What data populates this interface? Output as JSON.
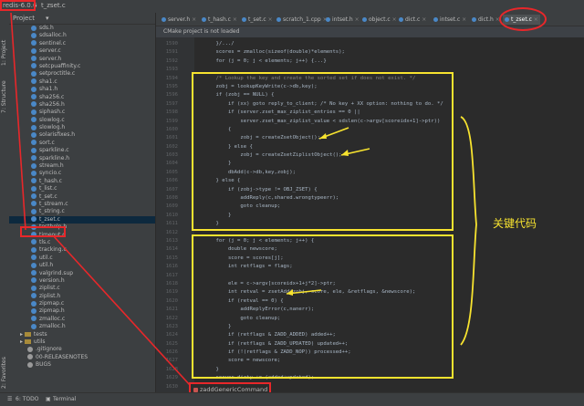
{
  "breadcrumb": {
    "project": "redis-6.0.6",
    "file": "t_zset.c"
  },
  "left_tool_tabs": [
    "1: Project",
    "7: Structure",
    "2: Favorites"
  ],
  "project_panel": {
    "title": "Project"
  },
  "files": [
    {
      "name": "sds.h",
      "selected": false
    },
    {
      "name": "sdsalloc.h",
      "selected": false
    },
    {
      "name": "sentinel.c",
      "selected": false
    },
    {
      "name": "server.c",
      "selected": false
    },
    {
      "name": "server.h",
      "selected": false
    },
    {
      "name": "setcpuaffinity.c",
      "selected": false
    },
    {
      "name": "setproctitle.c",
      "selected": false
    },
    {
      "name": "sha1.c",
      "selected": false
    },
    {
      "name": "sha1.h",
      "selected": false
    },
    {
      "name": "sha256.c",
      "selected": false
    },
    {
      "name": "sha256.h",
      "selected": false
    },
    {
      "name": "siphash.c",
      "selected": false
    },
    {
      "name": "slowlog.c",
      "selected": false
    },
    {
      "name": "slowlog.h",
      "selected": false
    },
    {
      "name": "solarisfixes.h",
      "selected": false
    },
    {
      "name": "sort.c",
      "selected": false
    },
    {
      "name": "sparkline.c",
      "selected": false
    },
    {
      "name": "sparkline.h",
      "selected": false
    },
    {
      "name": "stream.h",
      "selected": false
    },
    {
      "name": "syncio.c",
      "selected": false
    },
    {
      "name": "t_hash.c",
      "selected": false
    },
    {
      "name": "t_list.c",
      "selected": false
    },
    {
      "name": "t_set.c",
      "selected": false
    },
    {
      "name": "t_stream.c",
      "selected": false
    },
    {
      "name": "t_string.c",
      "selected": false
    },
    {
      "name": "t_zset.c",
      "selected": true
    },
    {
      "name": "testhelp.h",
      "selected": false
    },
    {
      "name": "timeout.c",
      "selected": false
    },
    {
      "name": "tls.c",
      "selected": false
    },
    {
      "name": "tracking.c",
      "selected": false
    },
    {
      "name": "util.c",
      "selected": false
    },
    {
      "name": "util.h",
      "selected": false
    },
    {
      "name": "valgrind.sup",
      "selected": false
    },
    {
      "name": "version.h",
      "selected": false
    },
    {
      "name": "ziplist.c",
      "selected": false
    },
    {
      "name": "ziplist.h",
      "selected": false
    },
    {
      "name": "zipmap.c",
      "selected": false
    },
    {
      "name": "zipmap.h",
      "selected": false
    },
    {
      "name": "zmalloc.c",
      "selected": false
    },
    {
      "name": "zmalloc.h",
      "selected": false
    }
  ],
  "folders": [
    {
      "name": "tests"
    },
    {
      "name": "utils"
    }
  ],
  "root_files": [
    ".gitignore",
    "00-RELEASENOTES",
    "BUGS"
  ],
  "editor_tabs": [
    {
      "label": "server.h",
      "active": false
    },
    {
      "label": "t_hash.c",
      "active": false
    },
    {
      "label": "t_set.c",
      "active": false
    },
    {
      "label": "scratch_1.cpp",
      "active": false
    },
    {
      "label": "intset.h",
      "active": false
    },
    {
      "label": "object.c",
      "active": false
    },
    {
      "label": "dict.c",
      "active": false
    },
    {
      "label": "intset.c",
      "active": false
    },
    {
      "label": "dict.h",
      "active": false
    },
    {
      "label": "t_zset.c",
      "active": true
    }
  ],
  "notice": "CMake project is not loaded",
  "line_numbers": [
    "1590",
    "1591",
    "1592",
    "1593",
    "1594",
    "1595",
    "1596",
    "1597",
    "1598",
    "1599",
    "1600",
    "1601",
    "1602",
    "1603",
    "1604",
    "1605",
    "1606",
    "1607",
    "1608",
    "1609",
    "1610",
    "1611",
    "1612",
    "1613",
    "1614",
    "1615",
    "1616",
    "1617",
    "1618",
    "1619",
    "1620",
    "1621",
    "1622",
    "1623",
    "1624",
    "1625",
    "1626",
    "1627",
    "1628",
    "1629",
    "1630",
    "1631",
    "1632",
    "1633",
    "1634",
    "1635",
    "1636",
    "1637",
    "1638",
    "1639",
    "1640"
  ],
  "code_lines": [
    "    }/.../",
    "    scores = zmalloc(sizeof(double)*elements);",
    "    for (j = 0; j < elements; j++) {...}",
    "",
    "    /* Lookup the key and create the sorted set if does not exist. */",
    "    zobj = lookupKeyWrite(c->db,key);",
    "    if (zobj == NULL) {",
    "        if (xx) goto reply_to_client; /* No key + XX option: nothing to do. */",
    "        if (server.zset_max_ziplist_entries == 0 ||",
    "            server.zset_max_ziplist_value < sdslen(c->argv[scoreidx+1]->ptr))",
    "        {",
    "            zobj = createZsetObject();",
    "        } else {",
    "            zobj = createZsetZiplistObject();",
    "        }",
    "        dbAdd(c->db,key,zobj);",
    "    } else {",
    "        if (zobj->type != OBJ_ZSET) {",
    "            addReply(c,shared.wrongtypeerr);",
    "            goto cleanup;",
    "        }",
    "    }",
    "",
    "    for (j = 0; j < elements; j++) {",
    "        double newscore;",
    "        score = scores[j];",
    "        int retflags = flags;",
    "",
    "        ele = c->argv[scoreidx+1+j*2]->ptr;",
    "        int retval = zsetAdd(zobj, score, ele, &retflags, &newscore);",
    "        if (retval == 0) {",
    "            addReplyError(c,nanerr);",
    "            goto cleanup;",
    "        }",
    "        if (retflags & ZADD_ADDED) added++;",
    "        if (retflags & ZADD_UPDATED) updated++;",
    "        if (!(retflags & ZADD_NOP)) processed++;",
    "        score = newscore;",
    "    }",
    "    server.dirty += (added+updated);",
    ""
  ],
  "annotation": "关键代码",
  "function_breadcrumb": "zaddGenericCommand",
  "bottom_bar": {
    "todo": "6: TODO",
    "terminal": "Terminal"
  },
  "colors": {
    "highlight_box": "#f7e32f",
    "callout": "#e8272a",
    "background": "#2b2b2b"
  }
}
